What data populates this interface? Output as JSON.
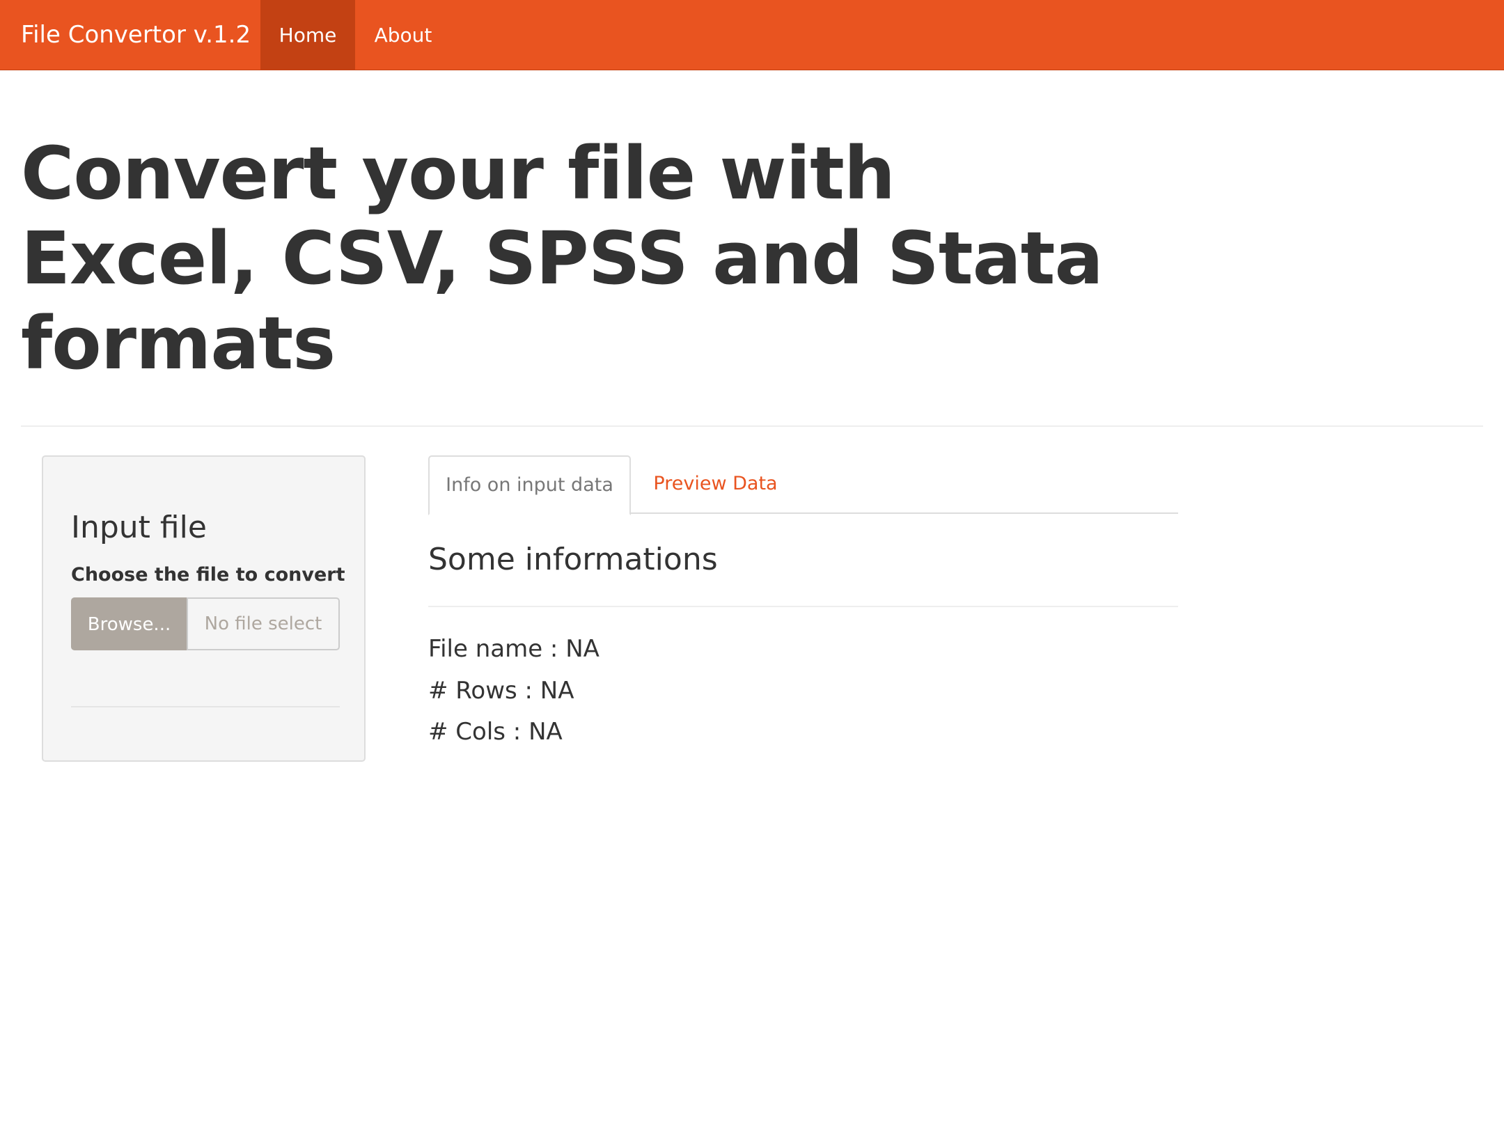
{
  "navbar": {
    "brand": "File Convertor v.1.2",
    "items": [
      {
        "label": "Home",
        "active": true
      },
      {
        "label": "About",
        "active": false
      }
    ],
    "accent_color": "#e95420"
  },
  "hero": {
    "lines": [
      "Convert your file with",
      "Excel, CSV, SPSS and Stata",
      "formats"
    ]
  },
  "sidebar": {
    "title": "Input file",
    "label": "Choose the file to convert",
    "browse_label": "Browse...",
    "file_placeholder": "No file select"
  },
  "tabs": [
    {
      "label": "Info on input data",
      "active": true
    },
    {
      "label": "Preview Data",
      "active": false
    }
  ],
  "info": {
    "title": "Some informations",
    "lines": [
      "File name : NA",
      "# Rows : NA",
      "# Cols : NA"
    ]
  }
}
